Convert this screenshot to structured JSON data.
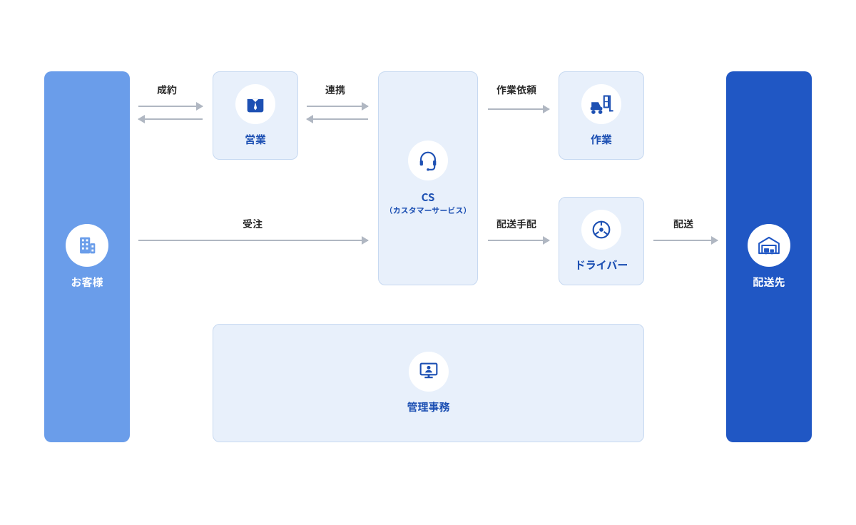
{
  "nodes": {
    "customer": {
      "title": "お客様"
    },
    "sales": {
      "title": "営業"
    },
    "cs": {
      "title": "CS",
      "subtitle": "（カスタマーサービス）"
    },
    "work": {
      "title": "作業"
    },
    "driver": {
      "title": "ドライバー"
    },
    "admin": {
      "title": "管理事務"
    },
    "dest": {
      "title": "配送先"
    }
  },
  "edges": {
    "contract": "成約",
    "link": "連携",
    "workReq": "作業依頼",
    "order": "受注",
    "dispatch": "配送手配",
    "delivery": "配送"
  },
  "colors": {
    "endpointCustomer": "#6a9dea",
    "endpointDest": "#2057c4",
    "innerBg": "#e8f0fb",
    "innerBorder": "#c7d9f1",
    "accentText": "#1d50b3",
    "arrow": "#b0b7c2",
    "label": "#2b2b2b"
  }
}
